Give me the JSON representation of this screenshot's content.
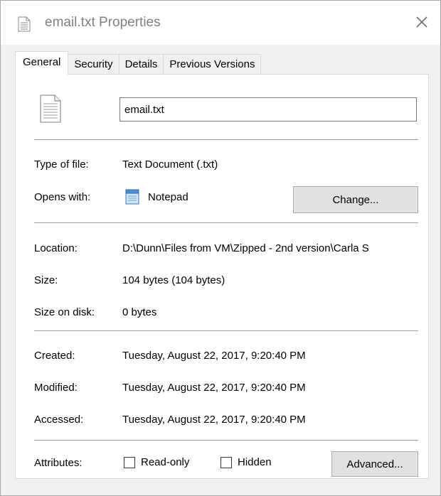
{
  "window": {
    "title": "email.txt Properties",
    "title_icon": "text-file-icon",
    "close_icon": "close-icon"
  },
  "tabs": [
    {
      "label": "General",
      "active": true
    },
    {
      "label": "Security",
      "active": false
    },
    {
      "label": "Details",
      "active": false
    },
    {
      "label": "Previous Versions",
      "active": false
    }
  ],
  "general": {
    "file_icon": "text-file-icon",
    "file_name": "email.txt",
    "type_label": "Type of file:",
    "type_value": "Text Document (.txt)",
    "opens_label": "Opens with:",
    "opens_icon": "notepad-icon",
    "opens_value": "Notepad",
    "change_button": "Change...",
    "location_label": "Location:",
    "location_value": "D:\\Dunn\\Files from VM\\Zipped - 2nd version\\Carla S",
    "size_label": "Size:",
    "size_value": "104 bytes (104 bytes)",
    "size_disk_label": "Size on disk:",
    "size_disk_value": "0 bytes",
    "created_label": "Created:",
    "created_value": "Tuesday, August 22, 2017, 9:20:40 PM",
    "modified_label": "Modified:",
    "modified_value": "Tuesday, August 22, 2017, 9:20:40 PM",
    "accessed_label": "Accessed:",
    "accessed_value": "Tuesday, August 22, 2017, 9:20:40 PM",
    "attributes_label": "Attributes:",
    "readonly_label": "Read-only",
    "readonly_checked": false,
    "hidden_label": "Hidden",
    "hidden_checked": false,
    "advanced_button": "Advanced..."
  },
  "colors": {
    "dialog_bg": "#f0f0f0",
    "panel_bg": "#ffffff",
    "button_bg": "#e1e1e1",
    "title_text": "#808080"
  }
}
